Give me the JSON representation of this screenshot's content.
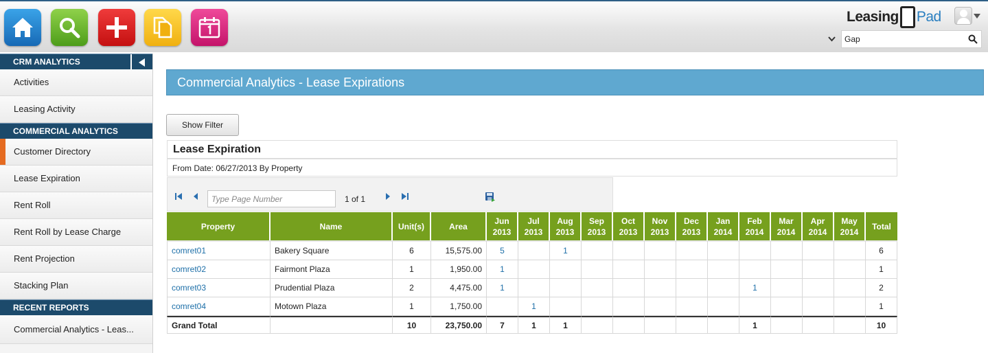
{
  "brand": {
    "part1": "Leasing",
    "part2": "Pad"
  },
  "search": {
    "value": "Gap"
  },
  "sidebar": {
    "sections": [
      {
        "title": "CRM ANALYTICS",
        "items": [
          "Activities",
          "Leasing Activity"
        ]
      },
      {
        "title": "COMMERCIAL ANALYTICS",
        "items": [
          "Customer Directory",
          "Lease Expiration",
          "Rent Roll",
          "Rent Roll by Lease Charge",
          "Rent Projection",
          "Stacking Plan"
        ]
      },
      {
        "title": "RECENT REPORTS",
        "items": [
          "Commercial Analytics - Leas..."
        ]
      }
    ],
    "active_item": "Customer Directory"
  },
  "page": {
    "title": "Commercial Analytics - Lease Expirations",
    "show_filter_label": "Show Filter"
  },
  "report": {
    "title": "Lease Expiration",
    "subtitle": "From Date: 06/27/2013 By Property",
    "pager": {
      "placeholder": "Type Page Number",
      "page_text": "1 of 1"
    },
    "columns": {
      "property": "Property",
      "name": "Name",
      "units": "Unit(s)",
      "area": "Area",
      "months": [
        [
          "Jun",
          "2013"
        ],
        [
          "Jul",
          "2013"
        ],
        [
          "Aug",
          "2013"
        ],
        [
          "Sep",
          "2013"
        ],
        [
          "Oct",
          "2013"
        ],
        [
          "Nov",
          "2013"
        ],
        [
          "Dec",
          "2013"
        ],
        [
          "Jan",
          "2014"
        ],
        [
          "Feb",
          "2014"
        ],
        [
          "Mar",
          "2014"
        ],
        [
          "Apr",
          "2014"
        ],
        [
          "May",
          "2014"
        ]
      ],
      "total": "Total"
    },
    "rows": [
      {
        "property": "comret01",
        "name": "Bakery Square",
        "units": "6",
        "area": "15,575.00",
        "months": [
          "5",
          "",
          "1",
          "",
          "",
          "",
          "",
          "",
          "",
          "",
          "",
          ""
        ],
        "total": "6"
      },
      {
        "property": "comret02",
        "name": "Fairmont Plaza",
        "units": "1",
        "area": "1,950.00",
        "months": [
          "1",
          "",
          "",
          "",
          "",
          "",
          "",
          "",
          "",
          "",
          "",
          ""
        ],
        "total": "1"
      },
      {
        "property": "comret03",
        "name": "Prudential Plaza",
        "units": "2",
        "area": "4,475.00",
        "months": [
          "1",
          "",
          "",
          "",
          "",
          "",
          "",
          "",
          "1",
          "",
          "",
          ""
        ],
        "total": "2"
      },
      {
        "property": "comret04",
        "name": "Motown Plaza",
        "units": "1",
        "area": "1,750.00",
        "months": [
          "",
          "1",
          "",
          "",
          "",
          "",
          "",
          "",
          "",
          "",
          "",
          ""
        ],
        "total": "1"
      }
    ],
    "grand_total": {
      "label": "Grand Total",
      "units": "10",
      "area": "23,750.00",
      "months": [
        "7",
        "1",
        "1",
        "",
        "",
        "",
        "",
        "",
        "1",
        "",
        "",
        ""
      ],
      "total": "10"
    }
  }
}
